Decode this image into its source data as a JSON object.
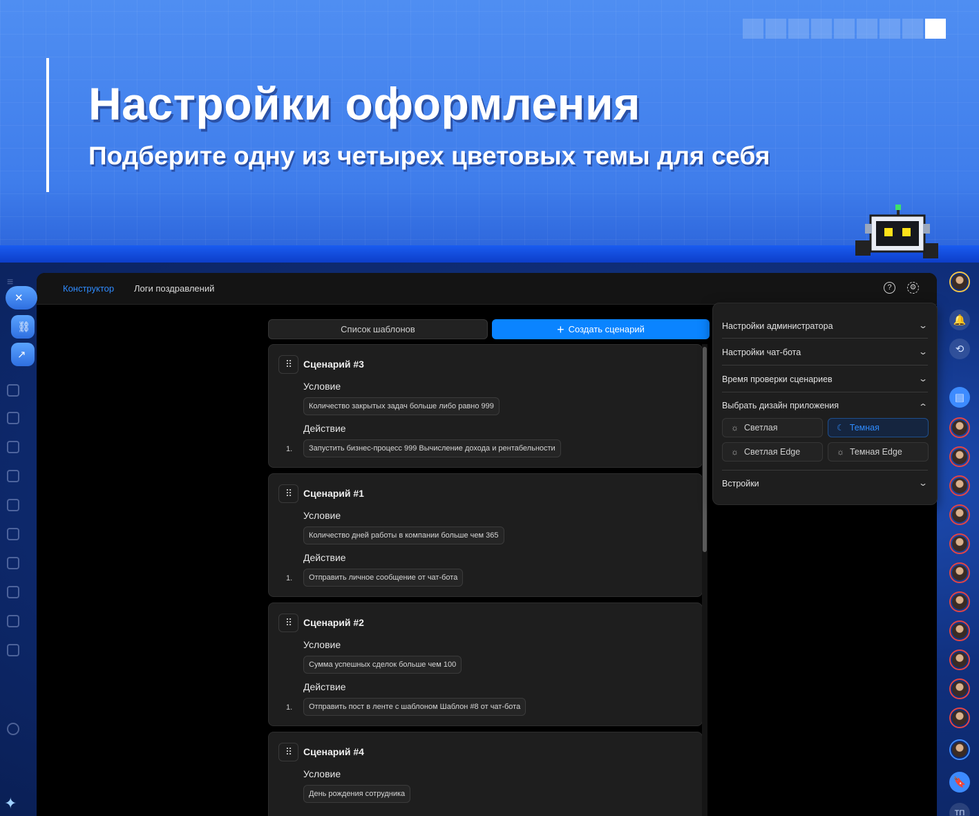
{
  "banner": {
    "title": "Настройки оформления",
    "subtitle": "Подберите одну из четырех цветовых темы для себя"
  },
  "topbar": {
    "tabs": [
      {
        "label": "Конструктор",
        "active": true
      },
      {
        "label": "Логи поздравлений",
        "active": false
      }
    ],
    "help_icon": "question-circle-icon",
    "settings_icon": "gear-icon"
  },
  "toolbar": {
    "templates_label": "Список шаблонов",
    "create_label": "Создать сценарий"
  },
  "scenarios": [
    {
      "title": "Сценарий #3",
      "condition_label": "Условие",
      "condition": "Количество закрытых задач больше либо равно 999",
      "action_label": "Действие",
      "action_num": "1.",
      "action": "Запустить бизнес-процесс 999 Вычисление дохода и рентабельности"
    },
    {
      "title": "Сценарий #1",
      "condition_label": "Условие",
      "condition": "Количество дней работы в компании больше чем 365",
      "action_label": "Действие",
      "action_num": "1.",
      "action": "Отправить личное сообщение от чат-бота"
    },
    {
      "title": "Сценарий #2",
      "condition_label": "Условие",
      "condition": "Сумма успешных сделок больше чем 100",
      "action_label": "Действие",
      "action_num": "1.",
      "action": "Отправить пост в ленте с шаблоном Шаблон #8 от чат-бота"
    },
    {
      "title": "Сценарий #4",
      "condition_label": "Условие",
      "condition": "День рождения сотрудника"
    }
  ],
  "settings_panel": {
    "sections": [
      "Настройки администратора",
      "Настройки чат-бота",
      "Время проверки сценариев",
      "Выбрать дизайн приложения",
      "Встройки"
    ],
    "themes": [
      {
        "label": "Светлая",
        "icon": "sun-icon",
        "selected": false
      },
      {
        "label": "Темная",
        "icon": "moon-icon",
        "selected": true
      },
      {
        "label": "Светлая Edge",
        "icon": "sun-icon",
        "selected": false
      },
      {
        "label": "Темная Edge",
        "icon": "sun-icon",
        "selected": false
      }
    ]
  },
  "right_rail": {
    "bottom_badge": "ТП"
  },
  "colors": {
    "accent": "#0a84ff",
    "window_bg": "#000000",
    "card_bg": "#1e1e1e",
    "banner_bg": "#4f8ef2"
  }
}
